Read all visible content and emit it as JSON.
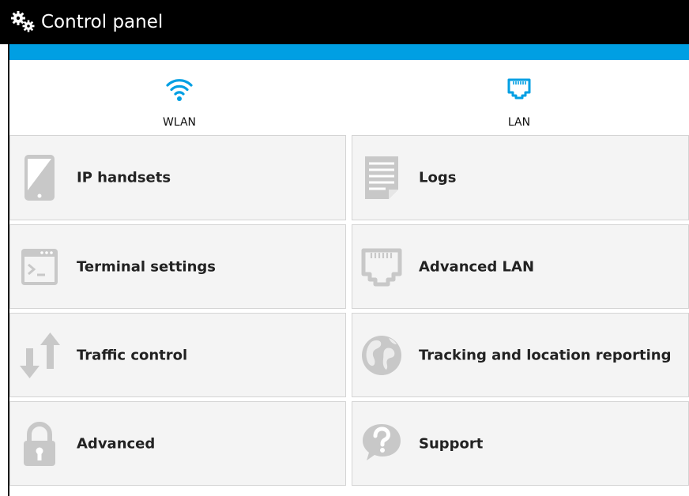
{
  "app": {
    "title": "Control panel",
    "title_icon": "gears-icon"
  },
  "colors": {
    "titlebar": "#000000",
    "accent": "#009fe3",
    "tile_bg": "#f4f4f4",
    "icon_grey": "#c8c8c8"
  },
  "nav": {
    "items": [
      {
        "label": "WLAN",
        "icon": "wifi-icon"
      },
      {
        "label": "LAN",
        "icon": "ethernet-port-icon"
      }
    ]
  },
  "tiles": [
    {
      "label": "IP handsets",
      "icon": "tablet-icon"
    },
    {
      "label": "Logs",
      "icon": "document-icon"
    },
    {
      "label": "Terminal settings",
      "icon": "terminal-icon"
    },
    {
      "label": "Advanced LAN",
      "icon": "ethernet-port-icon"
    },
    {
      "label": "Traffic control",
      "icon": "up-down-arrows-icon"
    },
    {
      "label": "Tracking and location reporting",
      "icon": "globe-icon"
    },
    {
      "label": "Advanced",
      "icon": "lock-icon"
    },
    {
      "label": "Support",
      "icon": "help-icon"
    }
  ]
}
